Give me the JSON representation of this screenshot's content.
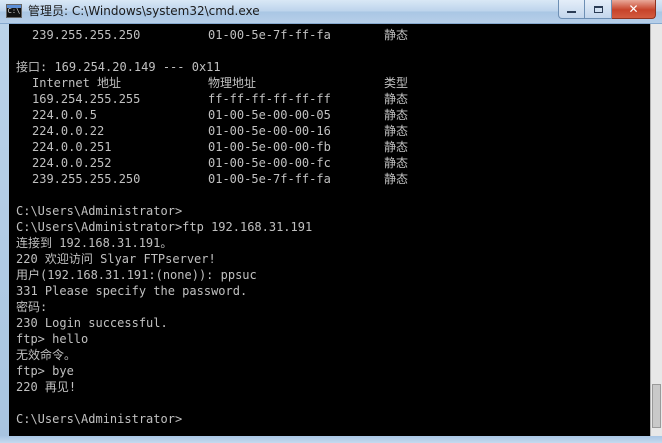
{
  "window": {
    "title": "管理员: C:\\Windows\\system32\\cmd.exe",
    "icon_text": "C:\\",
    "controls": {
      "minimize_icon": "minimize-icon",
      "maximize_icon": "maximize-icon",
      "close_icon": "close-icon",
      "close_glyph": "✕"
    }
  },
  "console": {
    "top_arp_row": {
      "ip": "239.255.255.250",
      "mac": "01-00-5e-7f-ff-fa",
      "type": "静态"
    },
    "interface_line": "接口: 169.254.20.149 --- 0x11",
    "arp_header": {
      "ip": "Internet 地址",
      "mac": "物理地址",
      "type": "类型"
    },
    "arp_rows": [
      {
        "ip": "169.254.255.255",
        "mac": "ff-ff-ff-ff-ff-ff",
        "type": "静态"
      },
      {
        "ip": "224.0.0.5",
        "mac": "01-00-5e-00-00-05",
        "type": "静态"
      },
      {
        "ip": "224.0.0.22",
        "mac": "01-00-5e-00-00-16",
        "type": "静态"
      },
      {
        "ip": "224.0.0.251",
        "mac": "01-00-5e-00-00-fb",
        "type": "静态"
      },
      {
        "ip": "224.0.0.252",
        "mac": "01-00-5e-00-00-fc",
        "type": "静态"
      },
      {
        "ip": "239.255.255.250",
        "mac": "01-00-5e-7f-ff-fa",
        "type": "静态"
      }
    ],
    "session_lines": [
      "C:\\Users\\Administrator>",
      "C:\\Users\\Administrator>ftp 192.168.31.191",
      "连接到 192.168.31.191。",
      "220 欢迎访问 Slyar FTPserver!",
      "用户(192.168.31.191:(none)): ppsuc",
      "331 Please specify the password.",
      "密码:",
      "230 Login successful.",
      "ftp> hello",
      "无效命令。",
      "ftp> bye",
      "220 再见!"
    ],
    "prompt_line": "C:\\Users\\Administrator>"
  }
}
